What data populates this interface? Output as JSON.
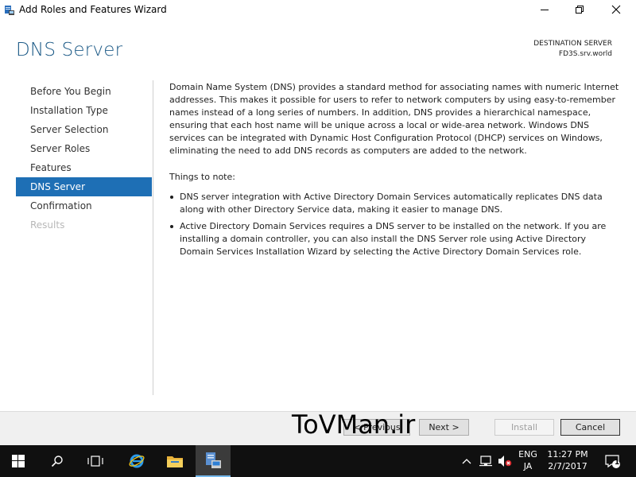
{
  "window": {
    "title": "Add Roles and Features Wizard"
  },
  "header": {
    "page_title": "DNS Server",
    "destination_label": "DESTINATION SERVER",
    "destination_server": "FD3S.srv.world"
  },
  "nav": {
    "items": [
      {
        "label": "Before You Begin",
        "state": "normal"
      },
      {
        "label": "Installation Type",
        "state": "normal"
      },
      {
        "label": "Server Selection",
        "state": "normal"
      },
      {
        "label": "Server Roles",
        "state": "normal"
      },
      {
        "label": "Features",
        "state": "normal"
      },
      {
        "label": "DNS Server",
        "state": "active"
      },
      {
        "label": "Confirmation",
        "state": "normal"
      },
      {
        "label": "Results",
        "state": "disabled"
      }
    ]
  },
  "content": {
    "intro": "Domain Name System (DNS) provides a standard method for associating names with numeric Internet addresses. This makes it possible for users to refer to network computers by using easy-to-remember names instead of a long series of numbers. In addition, DNS provides a hierarchical namespace, ensuring that each host name will be unique across a local or wide-area network. Windows DNS services can be integrated with Dynamic Host Configuration Protocol (DHCP) services on Windows, eliminating the need to add DNS records as computers are added to the network.",
    "things_heading": "Things to note:",
    "bullets": [
      "DNS server integration with Active Directory Domain Services automatically replicates DNS data along with other Directory Service data, making it easier to manage DNS.",
      "Active Directory Domain Services requires a DNS server to be installed on the network. If you are installing a domain controller, you can also install the DNS Server role using Active Directory Domain Services Installation Wizard by selecting the Active Directory Domain Services role."
    ]
  },
  "footer": {
    "previous_label": "< Previous",
    "next_label": "Next >",
    "install_label": "Install",
    "cancel_label": "Cancel",
    "watermark": "ToVMan.ir"
  },
  "taskbar": {
    "language_top": "ENG",
    "language_bottom": "JA",
    "time": "11:27 PM",
    "date": "2/7/2017",
    "notification_count": "1",
    "icons": [
      "start-icon",
      "search-icon",
      "task-view-icon",
      "internet-explorer-icon",
      "file-explorer-icon",
      "server-manager-icon"
    ]
  },
  "colors": {
    "accent": "#1e6fb5",
    "title_blue": "#1c5a87",
    "taskbar": "#101010"
  }
}
